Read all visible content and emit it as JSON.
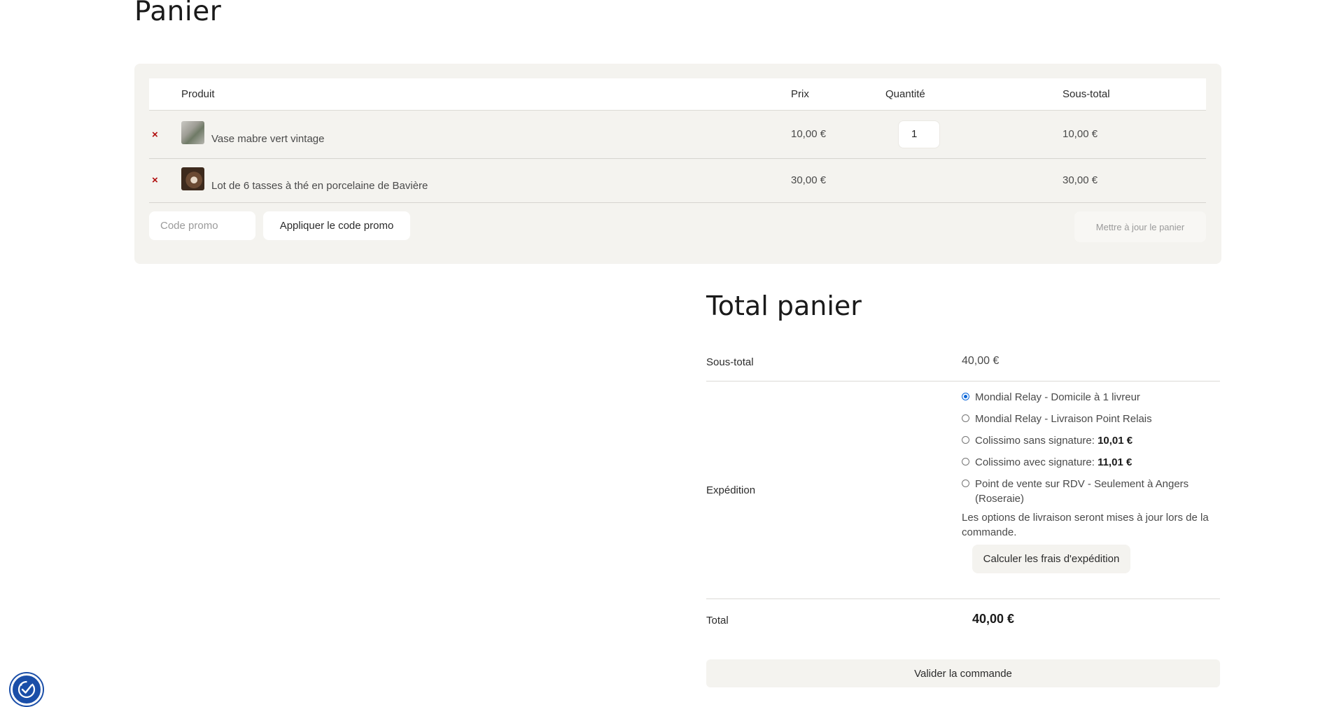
{
  "page": {
    "title": "Panier"
  },
  "cart": {
    "headers": {
      "product": "Produit",
      "price": "Prix",
      "quantity": "Quantité",
      "subtotal": "Sous-total"
    },
    "items": [
      {
        "name": "Vase mabre vert vintage",
        "price": "10,00 €",
        "quantity": "1",
        "subtotal": "10,00 €",
        "thumb_icon": "vase-thumbnail"
      },
      {
        "name": "Lot de 6 tasses à thé en porcelaine de Bavière",
        "price": "30,00 €",
        "quantity": "",
        "subtotal": "30,00 €",
        "thumb_icon": "teacups-thumbnail"
      }
    ],
    "remove_symbol": "×",
    "promo": {
      "placeholder": "Code promo",
      "value": ""
    },
    "apply_label": "Appliquer le code promo",
    "update_label": "Mettre à jour le panier"
  },
  "totals": {
    "title": "Total panier",
    "subtotal_label": "Sous-total",
    "subtotal_value": "40,00 €",
    "shipping_label": "Expédition",
    "shipping_options": [
      {
        "label": "Mondial Relay - Domicile à 1 livreur",
        "price": "",
        "selected": true
      },
      {
        "label": "Mondial Relay - Livraison Point Relais",
        "price": "",
        "selected": false
      },
      {
        "label": "Colissimo sans signature: ",
        "price": "10,01 €",
        "selected": false
      },
      {
        "label": "Colissimo avec signature: ",
        "price": "11,01 €",
        "selected": false
      },
      {
        "label": "Point de vente sur RDV - Seulement à Angers (Roseraie)",
        "price": "",
        "selected": false
      }
    ],
    "shipping_note": "Les options de livraison seront mises à jour lors de la commande.",
    "calc_label": "Calculer les frais d'expédition",
    "total_label": "Total",
    "total_value": "40,00 €",
    "checkout_label": "Valider la commande"
  },
  "accessibility": {
    "icon": "accessibility-icon",
    "color": "#1a4ea8"
  },
  "colors": {
    "remove": "#b10d0d",
    "radio_selected": "#0a66d8",
    "panel_bg": "#f4f3ef"
  }
}
